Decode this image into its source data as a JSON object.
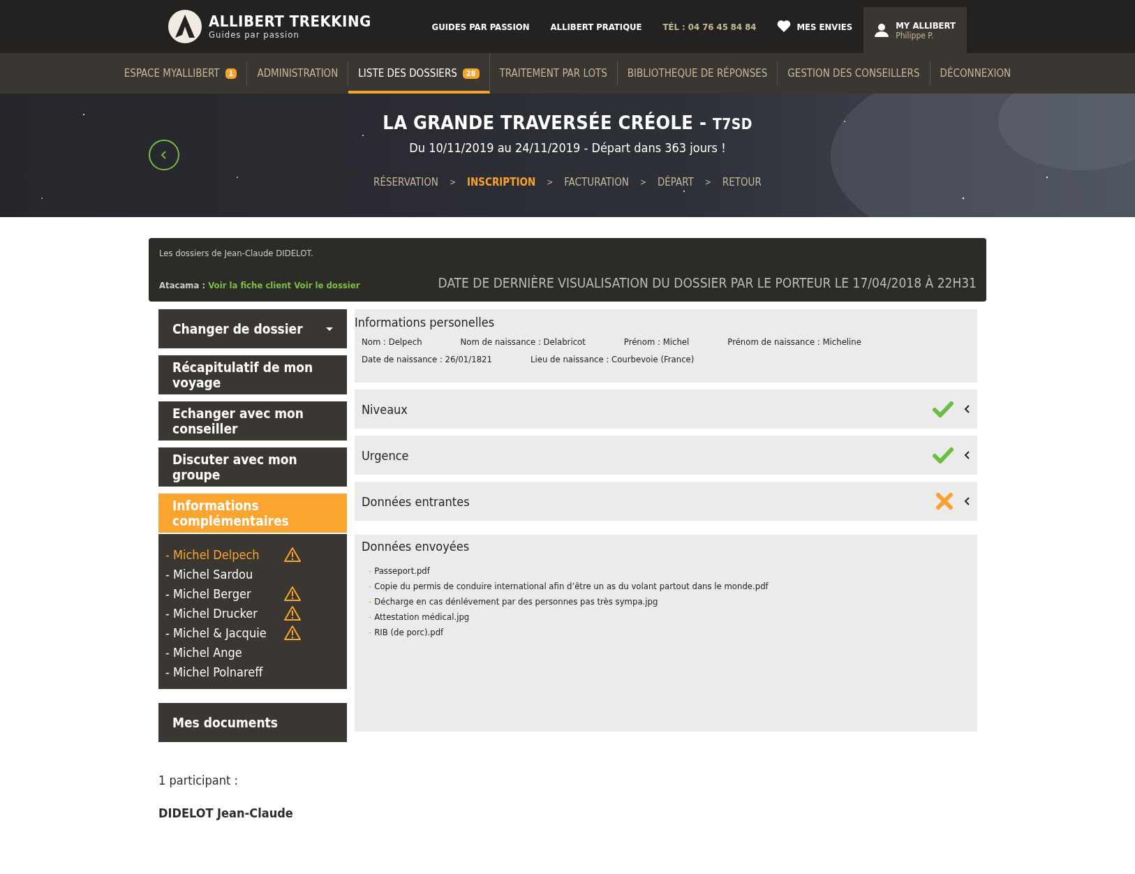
{
  "header": {
    "logo": {
      "title": "ALLIBERT TREKKING",
      "subtitle": "Guides par passion"
    },
    "links": [
      "GUIDES PAR PASSION",
      "ALLIBERT PRATIQUE"
    ],
    "phone": "TÉL : 04 76 45 84 84",
    "wishlist": "MES ENVIES",
    "account": {
      "title": "MY ALLIBERT",
      "name": "Philippe P."
    }
  },
  "nav": [
    {
      "label": "ESPACE MYALLIBERT",
      "badge": "1",
      "selected": false
    },
    {
      "label": "ADMINISTRATION",
      "selected": false
    },
    {
      "label": "LISTE DES DOSSIERS",
      "badge": "28",
      "selected": true
    },
    {
      "label": "TRAITEMENT PAR LOTS",
      "selected": false
    },
    {
      "label": "BIBLIOTHEQUE DE RÉPONSES",
      "selected": false
    },
    {
      "label": "GESTION DES CONSEILLERS",
      "selected": false
    },
    {
      "label": "DÉCONNEXION",
      "selected": false
    }
  ],
  "hero": {
    "title": "LA GRANDE TRAVERSÉE CRÉOLE -",
    "code": "T7SD",
    "dates": "Du 10/11/2019 au 24/11/2019 - Départ dans 363 jours !",
    "steps": [
      {
        "label": "RÉSERVATION",
        "selected": false,
        "next": ">"
      },
      {
        "label": "INSCRIPTION",
        "selected": true,
        "next": ">"
      },
      {
        "label": "FACTURATION",
        "selected": false,
        "next": ">"
      },
      {
        "label": "DÉPART",
        "selected": false,
        "next": ">"
      },
      {
        "label": "RETOUR",
        "selected": false
      }
    ]
  },
  "dossier": {
    "owner": "Les dossiers de Jean-Claude DIDELOT.",
    "source": "Atacama :",
    "links": [
      "Voir la fiche client",
      "Voir le dossier"
    ],
    "last_view": "DATE DE DERNIÈRE VISUALISATION DU DOSSIER PAR LE PORTEUR LE 17/04/2018 À 22H31"
  },
  "sidebar": [
    {
      "label": "Changer de dossier",
      "kind": "dropdown",
      "selected": false
    },
    {
      "label": "Récapitulatif de mon voyage",
      "kind": "link",
      "selected": false
    },
    {
      "label": "Echanger avec mon conseiller",
      "kind": "link",
      "selected": false
    },
    {
      "label": "Discuter avec mon groupe",
      "kind": "link",
      "selected": false
    },
    {
      "label": "Informations complémentaires",
      "kind": "link",
      "selected": true,
      "children": [
        {
          "label": "- Michel Delpech",
          "selected": true,
          "warning": true
        },
        {
          "label": "- Michel Sardou",
          "selected": false,
          "warning": false
        },
        {
          "label": "- Michel Berger",
          "selected": false,
          "warning": true
        },
        {
          "label": "- Michel Drucker",
          "selected": false,
          "warning": true
        },
        {
          "label": "- Michel & Jacquie",
          "selected": false,
          "warning": true
        },
        {
          "label": "- Michel Ange",
          "selected": false,
          "warning": false
        },
        {
          "label": "- Michel Polnareff",
          "selected": false,
          "warning": false
        }
      ]
    },
    {
      "label": "Mes documents",
      "kind": "link",
      "selected": false
    }
  ],
  "panels": [
    {
      "title": "Informations personelles",
      "kind": "fields",
      "rows": [
        [
          "Nom : Delpech",
          "Nom de naissance : Delabricot",
          "Prénom : Michel",
          "Prénom de naissance : Micheline"
        ],
        [
          "Date de naissance : 26/01/1821",
          "Lieu de naissance : Courbevoie (France)"
        ]
      ]
    },
    {
      "title": "Niveaux",
      "kind": "status",
      "complete": true
    },
    {
      "title": "Urgence",
      "kind": "status",
      "complete": true
    },
    {
      "title": "Données entrantes",
      "kind": "status",
      "complete": false
    },
    {
      "title": "Données envoyées",
      "kind": "files",
      "bullet": "-",
      "files": [
        "Passeport.pdf",
        "Copie du permis de conduire international afin d’être un as du volant partout dans le monde.pdf",
        "Décharge en cas dénlévement par des personnes pas très sympa.jpg",
        "Attestation médical.jpg",
        "RIB (de porc).pdf"
      ]
    }
  ],
  "participants": {
    "count": "1 participant :",
    "names": [
      "DIDELOT Jean-Claude"
    ]
  }
}
